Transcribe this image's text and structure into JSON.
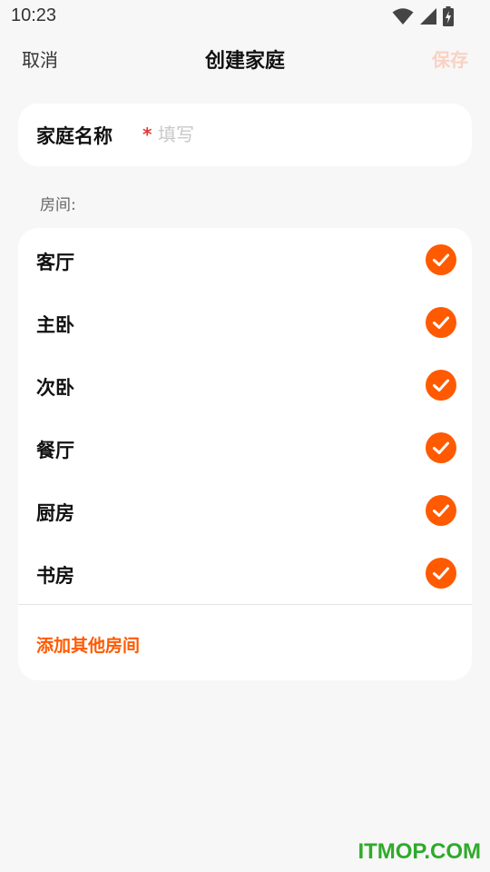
{
  "status_bar": {
    "time": "10:23",
    "icons": [
      "wifi-icon",
      "cellular-signal-icon",
      "battery-charging-icon"
    ]
  },
  "nav": {
    "cancel_label": "取消",
    "title": "创建家庭",
    "save_label": "保存"
  },
  "form": {
    "name_label": "家庭名称",
    "required_mark": "*",
    "name_placeholder": "填写",
    "name_value": ""
  },
  "rooms": {
    "section_label": "房间:",
    "items": [
      {
        "name": "客厅",
        "checked": true
      },
      {
        "name": "主卧",
        "checked": true
      },
      {
        "name": "次卧",
        "checked": true
      },
      {
        "name": "餐厅",
        "checked": true
      },
      {
        "name": "厨房",
        "checked": true
      },
      {
        "name": "书房",
        "checked": true
      }
    ],
    "add_label": "添加其他房间"
  },
  "watermark": "ITMOP.COM",
  "colors": {
    "accent": "#ff5a00",
    "save_disabled": "#f9d2c2",
    "required": "#e53935",
    "background": "#f7f7f7",
    "card": "#ffffff",
    "watermark": "#2faa2a"
  }
}
